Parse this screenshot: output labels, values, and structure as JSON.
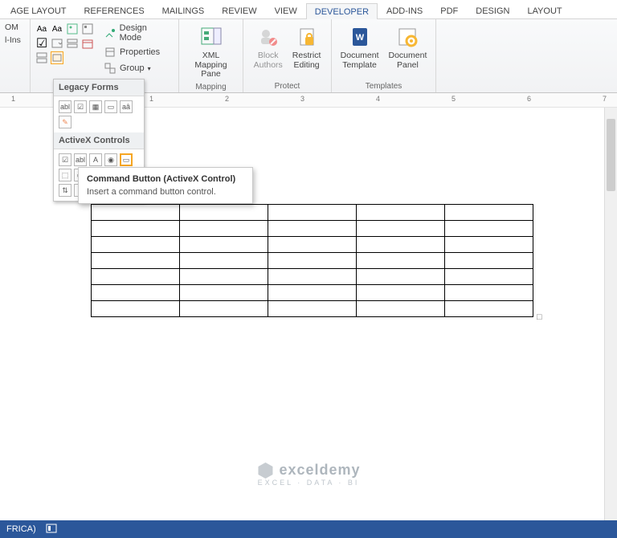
{
  "tabs": [
    "AGE LAYOUT",
    "REFERENCES",
    "MAILINGS",
    "REVIEW",
    "VIEW",
    "DEVELOPER",
    "ADD-INS",
    "PDF",
    "DESIGN",
    "LAYOUT"
  ],
  "active_tab": "DEVELOPER",
  "ribbon": {
    "left_partial": {
      "line1": "OM",
      "line2": "l-Ins"
    },
    "controls": {
      "design_mode": "Design Mode",
      "properties": "Properties",
      "group": "Group"
    },
    "mapping": {
      "btn": "XML Mapping\nPane",
      "label": "Mapping"
    },
    "protect": {
      "block": "Block\nAuthors",
      "restrict": "Restrict\nEditing",
      "label": "Protect"
    },
    "templates": {
      "tpl": "Document\nTemplate",
      "panel": "Document\nPanel",
      "label": "Templates"
    }
  },
  "ruler_marks": [
    "1",
    "1",
    "2",
    "3",
    "4",
    "5",
    "6",
    "7"
  ],
  "dropdown": {
    "legacy_title": "Legacy Forms",
    "activex_title": "ActiveX Controls",
    "legacy_icons": [
      "abl",
      "☑",
      "▦",
      "▭",
      "aâ",
      "✎"
    ],
    "activex_icons": [
      "☑",
      "abl",
      "A",
      "◉",
      "▭",
      "⬚",
      "▭",
      "▭",
      "⦿",
      "≡",
      "⇅",
      "⊞"
    ]
  },
  "tooltip": {
    "title": "Command Button (ActiveX Control)",
    "body": "Insert a command button control."
  },
  "table": {
    "rows": 7,
    "cols": 5
  },
  "statusbar": {
    "lang": "FRICA)"
  },
  "watermark": {
    "brand": "exceldemy",
    "tag": "EXCEL · DATA · BI"
  }
}
